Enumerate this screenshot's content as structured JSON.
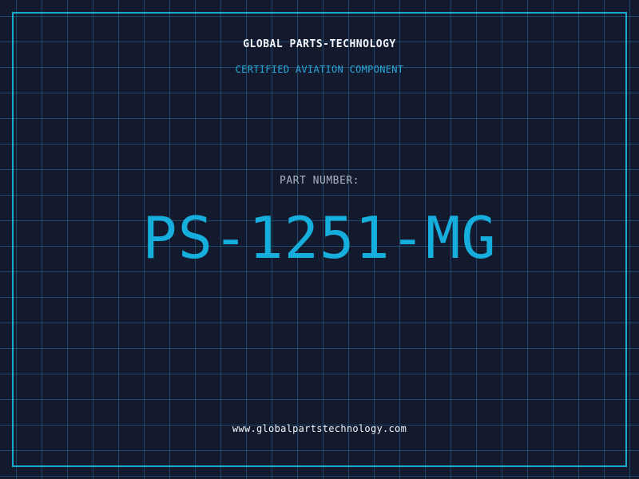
{
  "header": {
    "company": "GLOBAL PARTS-TECHNOLOGY",
    "tagline": "CERTIFIED AVIATION COMPONENT"
  },
  "part": {
    "label": "PART NUMBER:",
    "number": "PS-1251-MG"
  },
  "footer": {
    "website": "www.globalpartstechnology.com"
  },
  "colors": {
    "background": "#141a2e",
    "grid": "#286e96",
    "frame": "#1ea8cc",
    "accent": "#16aedd"
  }
}
